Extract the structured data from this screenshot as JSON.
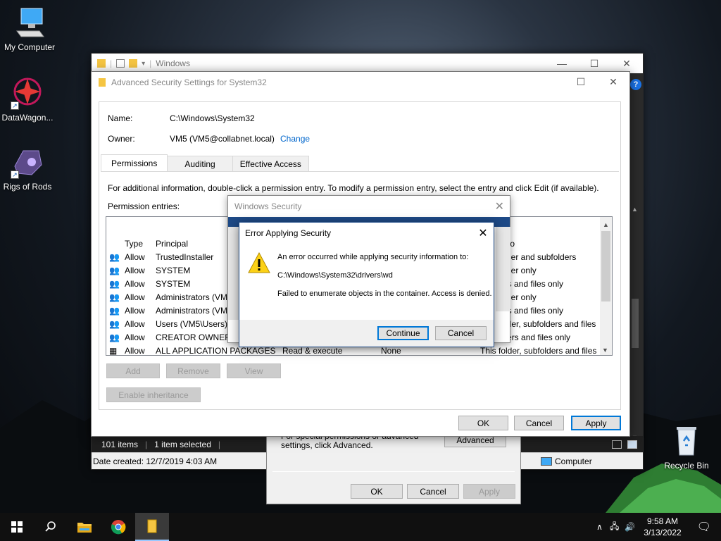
{
  "desktop": {
    "icons": [
      {
        "label": "My Computer"
      },
      {
        "label": "DataWagon..."
      },
      {
        "label": "Rigs of Rods"
      },
      {
        "label": "Recycle Bin"
      }
    ]
  },
  "explorer": {
    "title": "Windows",
    "status_items": "101 items",
    "status_selected": "1 item selected",
    "date_created": "Date created: 12/7/2019 4:03 AM",
    "location": "Computer"
  },
  "advanced": {
    "title": "Advanced Security Settings for System32",
    "name_label": "Name:",
    "name_value": "C:\\Windows\\System32",
    "owner_label": "Owner:",
    "owner_value": "VM5 (VM5@collabnet.local)",
    "change_link": "Change",
    "tabs": [
      "Permissions",
      "Auditing",
      "Effective Access"
    ],
    "info_text": "For additional information, double-click a permission entry. To modify a permission entry, select the entry and click Edit (if available).",
    "entries_label": "Permission entries:",
    "columns": {
      "type": "Type",
      "principal": "Principal",
      "applies": "to"
    },
    "rows": [
      {
        "type": "Allow",
        "principal": "TrustedInstaller",
        "access": "",
        "inherited": "",
        "applies": "der and subfolders"
      },
      {
        "type": "Allow",
        "principal": "SYSTEM",
        "access": "",
        "inherited": "",
        "applies": "der only"
      },
      {
        "type": "Allow",
        "principal": "SYSTEM",
        "access": "",
        "inherited": "",
        "applies": "ers and files only"
      },
      {
        "type": "Allow",
        "principal": "Administrators (VM",
        "access": "",
        "inherited": "",
        "applies": "der only"
      },
      {
        "type": "Allow",
        "principal": "Administrators (VM",
        "access": "",
        "inherited": "",
        "applies": "ers and files only"
      },
      {
        "type": "Allow",
        "principal": "Users (VM5\\Users)",
        "access": "",
        "inherited": "",
        "applies": "r, folder, subfolders and files"
      },
      {
        "type": "Allow",
        "principal": "CREATOR OWNER",
        "access": "",
        "inherited": "",
        "applies": "olders and files only"
      },
      {
        "type": "Allow",
        "principal": "ALL APPLICATION PACKAGES",
        "access": "Read & execute",
        "inherited": "None",
        "applies": "This folder, subfolders and files"
      }
    ],
    "add_btn": "Add",
    "remove_btn": "Remove",
    "view_btn": "View",
    "inherit_btn": "Enable inheritance",
    "ok_btn": "OK",
    "cancel_btn": "Cancel",
    "apply_btn": "Apply"
  },
  "props": {
    "text": "For special permissions or advanced settings, click Advanced.",
    "advanced_btn": "Advanced",
    "ok_btn": "OK",
    "cancel_btn": "Cancel",
    "apply_btn": "Apply"
  },
  "winsec": {
    "title": "Windows Security"
  },
  "error": {
    "title": "Error Applying Security",
    "line1": "An error occurred while applying security information to:",
    "line2": "C:\\Windows\\System32\\drivers\\wd",
    "line3": "Failed to enumerate objects in the container. Access is denied.",
    "continue_btn": "Continue",
    "cancel_btn": "Cancel"
  },
  "taskbar": {
    "time": "9:58 AM",
    "date": "3/13/2022"
  }
}
